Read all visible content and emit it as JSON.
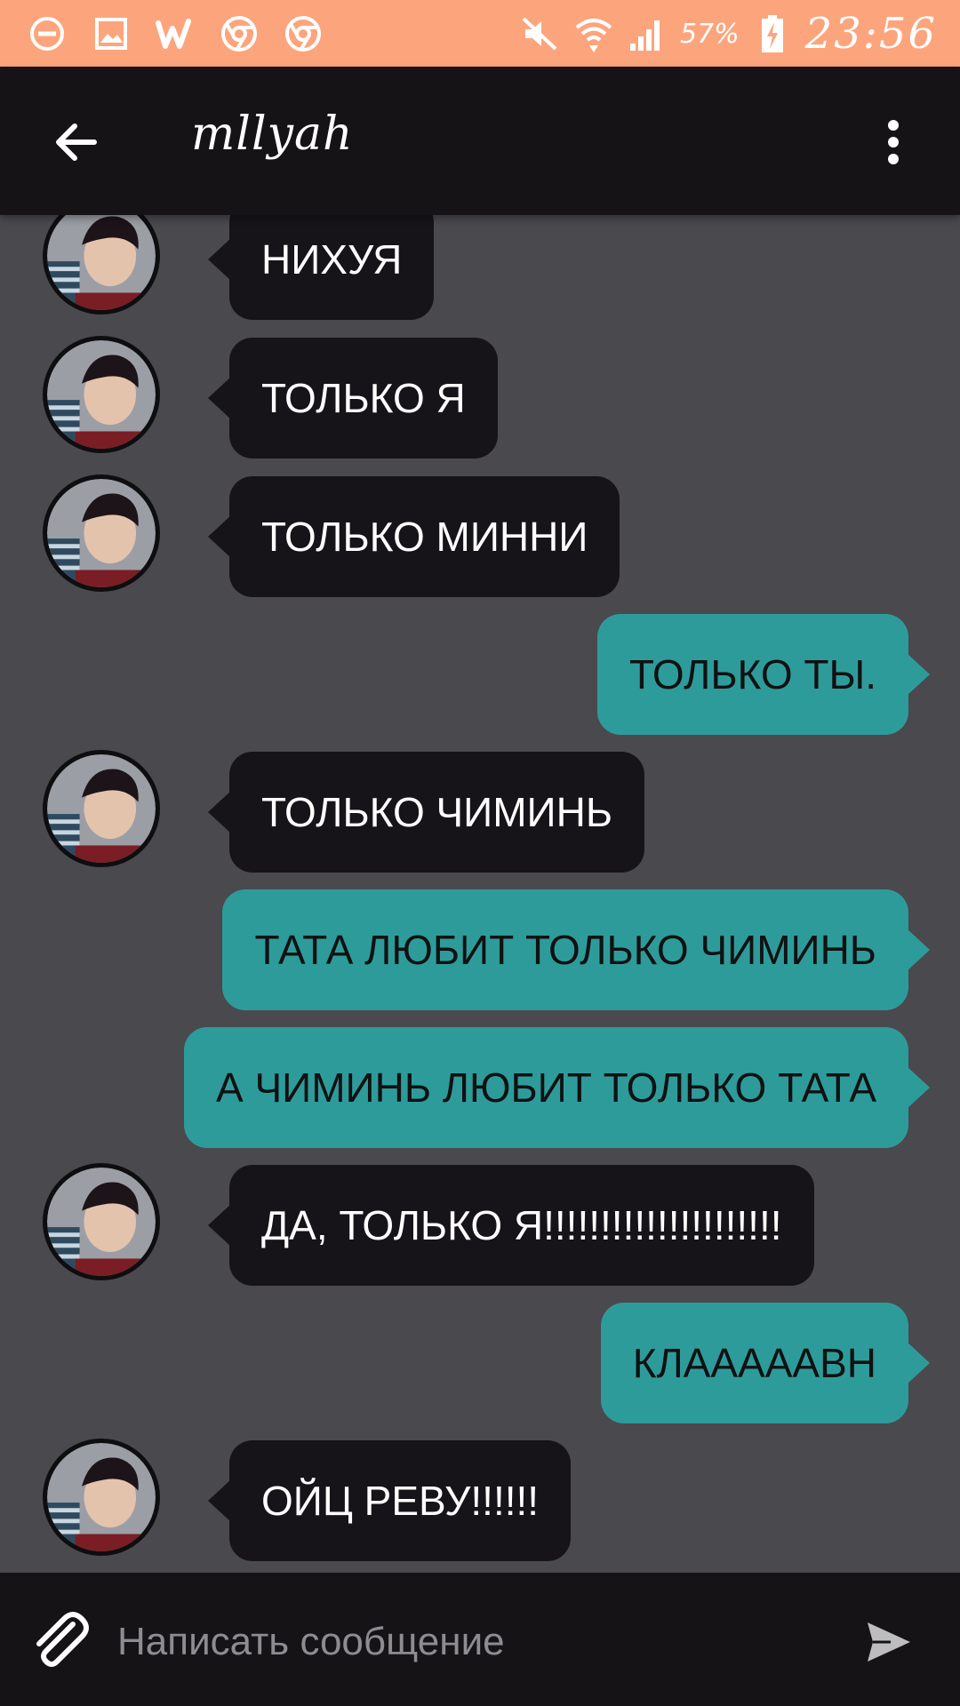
{
  "status_bar": {
    "left_icons": [
      "minus-circle-icon",
      "image-icon",
      "w-app-icon",
      "chrome-icon",
      "chrome-icon"
    ],
    "right_icons": [
      "mute-icon",
      "wifi-icon",
      "signal-icon",
      "battery-charging-icon"
    ],
    "battery": "57%",
    "time": "23:56"
  },
  "header": {
    "back_icon": "arrow-left-icon",
    "title": "mllyah",
    "menu_icon": "more-vertical-icon"
  },
  "messages": [
    {
      "direction": "in",
      "text": "НИХУЯ"
    },
    {
      "direction": "in",
      "text": "ТОЛЬКО Я"
    },
    {
      "direction": "in",
      "text": "ТОЛЬКО МИННИ"
    },
    {
      "direction": "out",
      "text": "ТОЛЬКО ТЫ."
    },
    {
      "direction": "in",
      "text": "ТОЛЬКО ЧИМИНЬ"
    },
    {
      "direction": "out",
      "text": "ТАТА ЛЮБИТ ТОЛЬКО ЧИМИНЬ"
    },
    {
      "direction": "out",
      "text": "А ЧИМИНЬ ЛЮБИТ ТОЛЬКО ТАТА"
    },
    {
      "direction": "in",
      "text": "ДА, ТОЛЬКО Я!!!!!!!!!!!!!!!!!!!!!"
    },
    {
      "direction": "out",
      "text": "КЛААААAВН"
    },
    {
      "direction": "in",
      "text": "ОЙЦ РЕВУ!!!!!!"
    }
  ],
  "composer": {
    "attach_icon": "paperclip-icon",
    "placeholder": "Написать сообщение",
    "value": "",
    "send_icon": "send-icon"
  },
  "colors": {
    "status_bar": "#fca57d",
    "app_bar": "#151316",
    "chat_background": "#4a494e",
    "incoming_bubble": "#161418",
    "outgoing_bubble": "#2e9b9b"
  }
}
